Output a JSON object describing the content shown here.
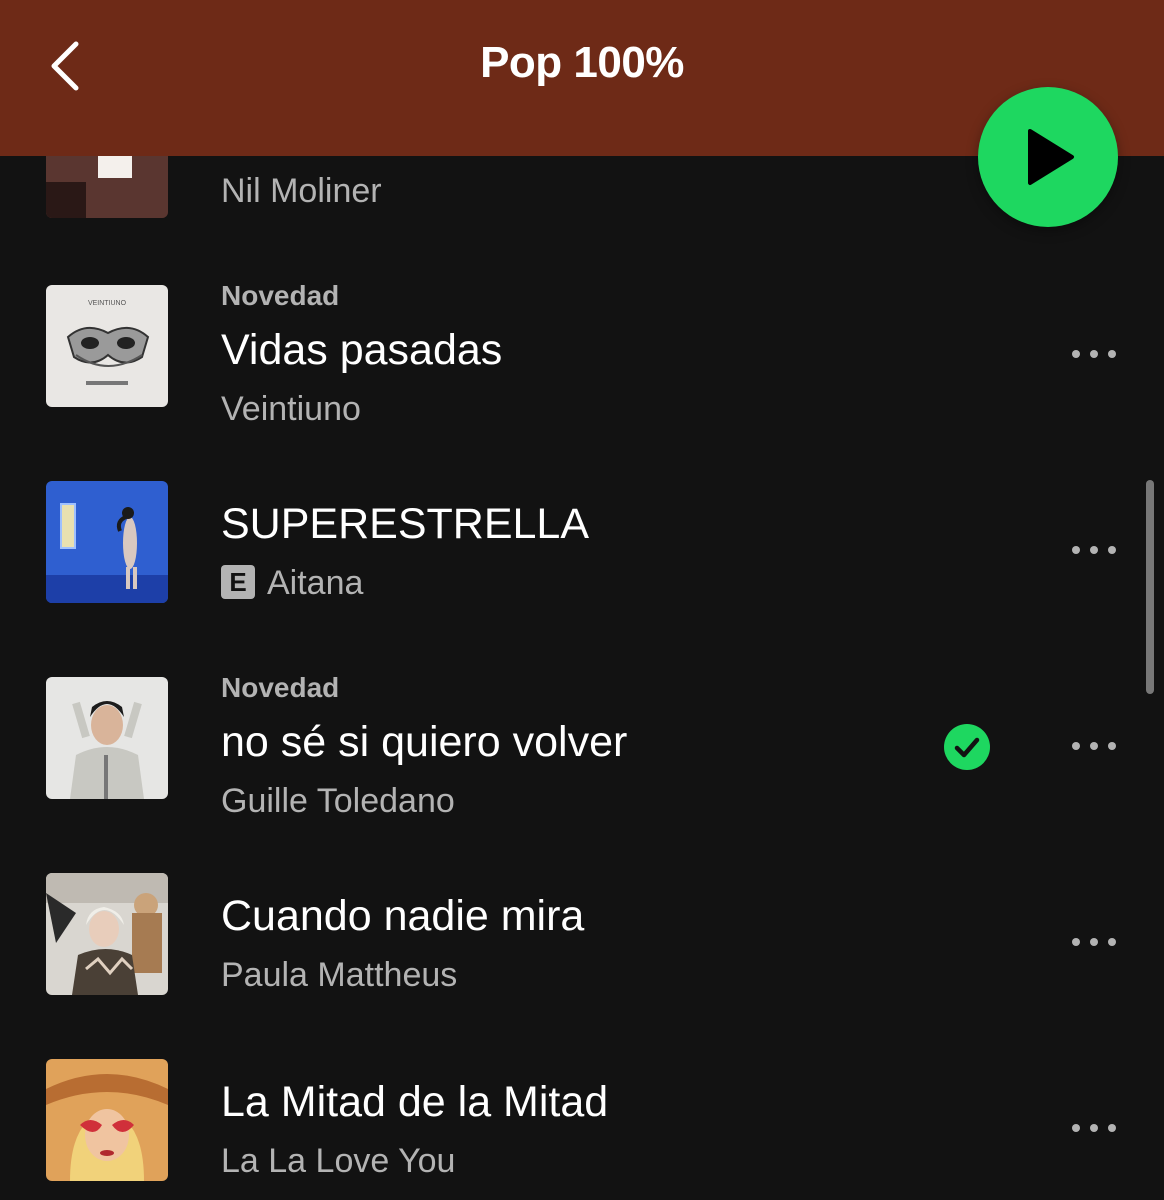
{
  "header": {
    "title": "Pop 100%"
  },
  "colors": {
    "accent": "#1ed760",
    "header_bg": "#6e2a17",
    "background": "#121212"
  },
  "tracks": [
    {
      "artist": "Nil Moliner"
    },
    {
      "tag": "Novedad",
      "title": "Vidas pasadas",
      "artist": "Veintiuno"
    },
    {
      "title": "SUPERESTRELLA",
      "artist": "Aitana",
      "explicit": "E"
    },
    {
      "tag": "Novedad",
      "title": "no sé si quiero volver",
      "artist": "Guille Toledano",
      "saved": true
    },
    {
      "title": "Cuando nadie mira",
      "artist": "Paula Mattheus"
    },
    {
      "title": "La Mitad de la Mitad",
      "artist": "La La Love You"
    }
  ]
}
